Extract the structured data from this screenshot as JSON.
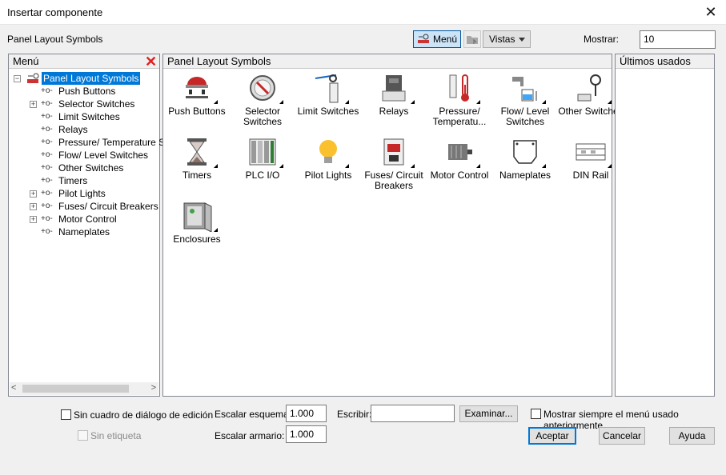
{
  "window": {
    "title": "Insertar componente",
    "close_label": "✕"
  },
  "toolbar": {
    "breadcrumb": "Panel Layout Symbols",
    "menu_button": "Menú",
    "views_button": "Vistas",
    "show_label": "Mostrar:",
    "show_value": "10"
  },
  "left_panel": {
    "header": "Menú",
    "close_icon": "✕",
    "root_label": "Panel Layout Symbols",
    "items": [
      {
        "label": "Push Buttons",
        "expandable": false
      },
      {
        "label": "Selector Switches",
        "expandable": true
      },
      {
        "label": "Limit Switches",
        "expandable": false
      },
      {
        "label": "Relays",
        "expandable": false
      },
      {
        "label": "Pressure/ Temperature Sw",
        "expandable": false
      },
      {
        "label": "Flow/ Level Switches",
        "expandable": false
      },
      {
        "label": "Other Switches",
        "expandable": false
      },
      {
        "label": "Timers",
        "expandable": false
      },
      {
        "label": "Pilot Lights",
        "expandable": true
      },
      {
        "label": "Fuses/ Circuit Breakers",
        "expandable": true
      },
      {
        "label": "Motor Control",
        "expandable": true
      },
      {
        "label": "Nameplates",
        "expandable": false
      }
    ]
  },
  "center_panel": {
    "header": "Panel Layout Symbols",
    "symbols": [
      {
        "label": "Push Buttons",
        "icon": "push-button-icon"
      },
      {
        "label": "Selector\nSwitches",
        "icon": "selector-switch-icon"
      },
      {
        "label": "Limit Switches",
        "icon": "limit-switch-icon"
      },
      {
        "label": "Relays",
        "icon": "relay-icon"
      },
      {
        "label": "Pressure/\nTemperatu...",
        "icon": "thermometer-icon"
      },
      {
        "label": "Flow/ Level\nSwitches",
        "icon": "flow-level-icon"
      },
      {
        "label": "Other Switches",
        "icon": "other-switch-icon"
      },
      {
        "label": "Timers",
        "icon": "hourglass-icon"
      },
      {
        "label": "PLC I/O",
        "icon": "plc-io-icon"
      },
      {
        "label": "Pilot Lights",
        "icon": "light-bulb-icon"
      },
      {
        "label": "Fuses/ Circuit\nBreakers",
        "icon": "fuse-breaker-icon"
      },
      {
        "label": "Motor Control",
        "icon": "motor-icon"
      },
      {
        "label": "Nameplates",
        "icon": "nameplate-icon"
      },
      {
        "label": "DIN Rail",
        "icon": "din-rail-icon"
      },
      {
        "label": "Enclosures",
        "icon": "enclosure-icon"
      }
    ]
  },
  "right_panel": {
    "header": "Últimos usados"
  },
  "bottom": {
    "no_dialog_label": "Sin cuadro de diálogo de edición",
    "no_tag_label": "Sin etiqueta",
    "scale_schematic_label": "Escalar esquema:",
    "scale_schematic_value": "1.000",
    "scale_panel_label": "Escalar armario:",
    "scale_panel_value": "1.000",
    "type_label": "Escribir:",
    "type_value": "",
    "browse_button": "Examinar...",
    "always_show_label": "Mostrar siempre el menú usado anteriormente",
    "ok_button": "Aceptar",
    "cancel_button": "Cancelar",
    "help_button": "Ayuda"
  }
}
